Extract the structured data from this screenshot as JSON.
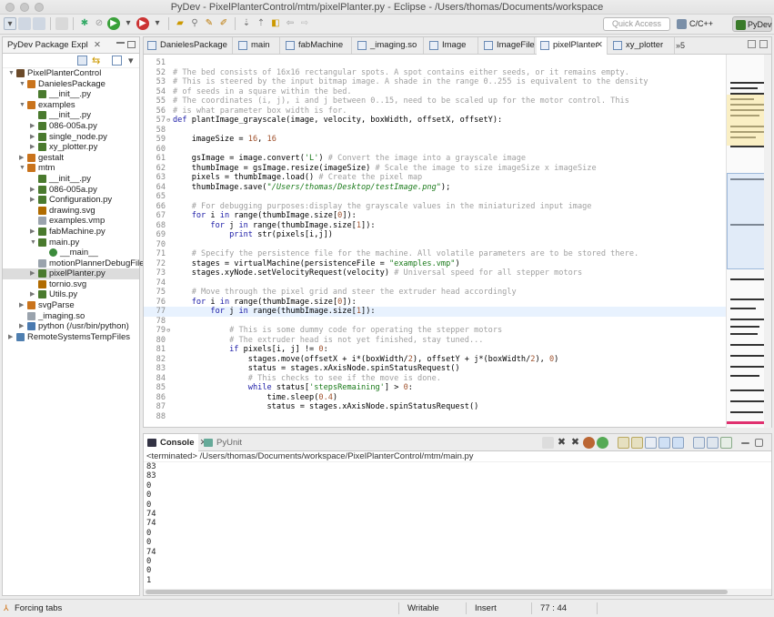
{
  "window": {
    "title": "PyDev - PixelPlanterControl/mtm/pixelPlanter.py - Eclipse - /Users/thomas/Documents/workspace"
  },
  "toolbar": {
    "quick_access_placeholder": "Quick Access",
    "perspective_cc": "C/C++",
    "perspective_pydev": "PyDev"
  },
  "package_explorer": {
    "tab_label": "PyDev Package Expl",
    "tree": [
      {
        "label": "PixelPlanterControl",
        "arrow": "▼",
        "icon": "project"
      },
      {
        "label": "DanielesPackage",
        "arrow": "▼",
        "icon": "package"
      },
      {
        "label": "__init__.py",
        "arrow": "",
        "icon": "pyfile"
      },
      {
        "label": "examples",
        "arrow": "▼",
        "icon": "package"
      },
      {
        "label": "__init__.py",
        "arrow": "",
        "icon": "pyfile"
      },
      {
        "label": "086-005a.py",
        "arrow": "▶",
        "icon": "pyfile"
      },
      {
        "label": "single_node.py",
        "arrow": "▶",
        "icon": "pyfile"
      },
      {
        "label": "xy_plotter.py",
        "arrow": "▶",
        "icon": "pyfile"
      },
      {
        "label": "gestalt",
        "arrow": "▶",
        "icon": "package"
      },
      {
        "label": "mtm",
        "arrow": "▼",
        "icon": "package"
      },
      {
        "label": "__init__.py",
        "arrow": "",
        "icon": "pyfile"
      },
      {
        "label": "086-005a.py",
        "arrow": "▶",
        "icon": "pyfile"
      },
      {
        "label": "Configuration.py",
        "arrow": "▶",
        "icon": "pyfile"
      },
      {
        "label": "drawing.svg",
        "arrow": "",
        "icon": "svg"
      },
      {
        "label": "examples.vmp",
        "arrow": "",
        "icon": "txt"
      },
      {
        "label": "fabMachine.py",
        "arrow": "▶",
        "icon": "pyfile"
      },
      {
        "label": "main.py",
        "arrow": "▼",
        "icon": "pyfile"
      },
      {
        "label": "__main__",
        "arrow": "",
        "icon": "method"
      },
      {
        "label": "motionPlannerDebugFile.tx",
        "arrow": "",
        "icon": "txt"
      },
      {
        "label": "pixelPlanter.py",
        "arrow": "▶",
        "icon": "pyfile"
      },
      {
        "label": "tornio.svg",
        "arrow": "",
        "icon": "svg"
      },
      {
        "label": "Utils.py",
        "arrow": "▶",
        "icon": "pyfile"
      },
      {
        "label": "svgParse",
        "arrow": "▶",
        "icon": "package"
      },
      {
        "label": "_imaging.so",
        "arrow": "",
        "icon": "txt"
      },
      {
        "label": "python  (/usr/bin/python)",
        "arrow": "▶",
        "icon": "interp"
      },
      {
        "label": "RemoteSystemsTempFiles",
        "arrow": "▶",
        "icon": "folder"
      }
    ]
  },
  "editor": {
    "tabs": [
      {
        "label": "DanielesPackage"
      },
      {
        "label": "main"
      },
      {
        "label": "fabMachine"
      },
      {
        "label": "_imaging.so"
      },
      {
        "label": "Image"
      },
      {
        "label": "ImageFile"
      },
      {
        "label": "pixelPlanter"
      },
      {
        "label": "xy_plotter"
      }
    ],
    "more_tabs": "»5",
    "lines": [
      {
        "n": "51",
        "t": "",
        "cls": "c-ud"
      },
      {
        "n": "52",
        "t": "# The bed consists of 16x16 rectangular spots. A spot contains either seeds, or it remains empty.",
        "cls": "c-cm"
      },
      {
        "n": "53",
        "t": "# This is steered by the input bitmap image. A shade in the range 0..255 is equivalent to the density",
        "cls": "c-cm"
      },
      {
        "n": "54",
        "t": "# of seeds in a square within the bed.",
        "cls": "c-cm"
      },
      {
        "n": "55",
        "t": "# The coordinates (i, j), i and j between 0..15, need to be scaled up for the motor control. This",
        "cls": "c-cm"
      },
      {
        "n": "56",
        "t": "# is what parameter box width is for.",
        "cls": "c-cm"
      },
      {
        "n": "57",
        "t": "def plantImage_grayscale(image, velocity, boxWidth, offsetX, offsetY):",
        "cls": "c-ud"
      },
      {
        "n": "58",
        "t": "",
        "cls": "c-ud"
      },
      {
        "n": "59",
        "t": "    imageSize = 16, 16",
        "cls": "c-ud"
      },
      {
        "n": "60",
        "t": "",
        "cls": "c-ud"
      },
      {
        "n": "61",
        "t": "    gsImage = image.convert('L') # Convert the image into a grayscale image",
        "cls": "c-ud"
      },
      {
        "n": "62",
        "t": "    thumbImage = gsImage.resize(imageSize) # Scale the image to size imageSize x imageSize",
        "cls": "c-ud"
      },
      {
        "n": "63",
        "t": "    pixels = thumbImage.load() # Create the pixel map",
        "cls": "c-ud"
      },
      {
        "n": "64",
        "t": "    thumbImage.save(\"/Users/thomas/Desktop/testImage.png\");",
        "cls": "c-ud"
      },
      {
        "n": "65",
        "t": "",
        "cls": "c-ud"
      },
      {
        "n": "66",
        "t": "    # For debugging purposes:display the grayscale values in the miniaturized input image",
        "cls": "c-cm"
      },
      {
        "n": "67",
        "t": "    for i in range(thumbImage.size[0]):",
        "cls": "c-ud"
      },
      {
        "n": "68",
        "t": "        for j in range(thumbImage.size[1]):",
        "cls": "c-ud"
      },
      {
        "n": "69",
        "t": "            print str(pixels[i,j])",
        "cls": "c-ud"
      },
      {
        "n": "70",
        "t": "",
        "cls": "c-ud"
      },
      {
        "n": "71",
        "t": "    # Specify the persistence file for the machine. All volatile parameters are to be stored there.",
        "cls": "c-cm"
      },
      {
        "n": "72",
        "t": "    stages = virtualMachine(persistenceFile = \"examples.vmp\")",
        "cls": "c-ud"
      },
      {
        "n": "73",
        "t": "    stages.xyNode.setVelocityRequest(velocity) # Universal speed for all stepper motors",
        "cls": "c-ud"
      },
      {
        "n": "74",
        "t": "",
        "cls": "c-ud"
      },
      {
        "n": "75",
        "t": "    # Move through the pixel grid and steer the extruder head accordingly",
        "cls": "c-cm"
      },
      {
        "n": "76",
        "t": "    for i in range(thumbImage.size[0]):",
        "cls": "c-ud"
      },
      {
        "n": "77",
        "t": "        for j in range(thumbImage.size[1]):",
        "cls": "c-ud"
      },
      {
        "n": "78",
        "t": "",
        "cls": "c-ud"
      },
      {
        "n": "79",
        "t": "            # This is some dummy code for operating the stepper motors",
        "cls": "c-cm"
      },
      {
        "n": "80",
        "t": "            # The extruder head is not yet finished, stay tuned...",
        "cls": "c-cm"
      },
      {
        "n": "81",
        "t": "            if pixels[i, j] != 0:",
        "cls": "c-ud"
      },
      {
        "n": "82",
        "t": "                stages.move(offsetX + i*(boxWidth/2), offsetY + j*(boxWidth/2), 0)",
        "cls": "c-ud"
      },
      {
        "n": "83",
        "t": "                status = stages.xAxisNode.spinStatusRequest()",
        "cls": "c-ud"
      },
      {
        "n": "84",
        "t": "                # This checks to see if the move is done.",
        "cls": "c-cm"
      },
      {
        "n": "85",
        "t": "                while status['stepsRemaining'] > 0:",
        "cls": "c-ud"
      },
      {
        "n": "86",
        "t": "                    time.sleep(0.4)",
        "cls": "c-ud"
      },
      {
        "n": "87",
        "t": "                    status = stages.xAxisNode.spinStatusRequest()",
        "cls": "c-ud"
      },
      {
        "n": "88",
        "t": "",
        "cls": "c-ud"
      }
    ]
  },
  "console": {
    "tab_console": "Console",
    "tab_pyunit": "PyUnit",
    "terminated": "<terminated> /Users/thomas/Documents/workspace/PixelPlanterControl/mtm/main.py",
    "output": [
      "83",
      "83",
      "0",
      "0",
      "0",
      "74",
      "74",
      "0",
      "0",
      "74",
      "0",
      "0",
      "1"
    ]
  },
  "statusbar": {
    "message": "Forcing tabs",
    "writable": "Writable",
    "mode": "Insert",
    "position": "77 : 44"
  }
}
